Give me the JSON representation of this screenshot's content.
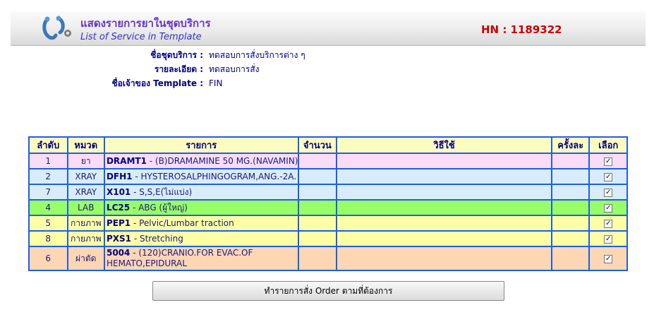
{
  "header": {
    "title_th": "แสดงรายการยาในชุดบริการ",
    "title_en": "List of Service in Template",
    "hn_label": "HN : 1189322",
    "logo_icon": "stethoscope-logo-icon"
  },
  "info": {
    "service_set_label": "ชื่อชุดบริการ :",
    "service_set_value": "ทดสอบการสั่งบริการต่าง ๆ",
    "detail_label": "รายละเอียด :",
    "detail_value": "ทดสอบการสั่ง",
    "owner_label": "ชื่อเจ้าของ Template :",
    "owner_value": "FIN"
  },
  "table": {
    "headers": {
      "seq": "ลำดับ",
      "category": "หมวด",
      "item": "รายการ",
      "quantity": "จำนวน",
      "usage": "วิธีใช้",
      "times": "ครั้งละ",
      "select": "เลือก"
    },
    "rows": [
      {
        "seq": "1",
        "category": "ยา",
        "code": "DRAMT1",
        "desc": " - (B)DRAMAMINE 50 MG.(NAVAMIN)",
        "checked": "✓",
        "color": "#fbdcf5"
      },
      {
        "seq": "2",
        "category": "XRAY",
        "code": "DFH1",
        "desc": " - HYSTEROSALPHINGOGRAM,ANG.-2A.",
        "checked": "✓",
        "color": "#d8ecfb"
      },
      {
        "seq": "7",
        "category": "XRAY",
        "code": "X101",
        "desc": " - S,S,E(ไม่แบ่ง)",
        "checked": "✓",
        "color": "#d8ecfb"
      },
      {
        "seq": "4",
        "category": "LAB",
        "code": "LC25",
        "desc": " - ABG (ผู้ใหญ่)",
        "checked": "✓",
        "color": "#99ff66"
      },
      {
        "seq": "5",
        "category": "กายภาพ",
        "code": "PEP1",
        "desc": " - Pelvic/Lumbar traction",
        "checked": "✓",
        "color": "#fefea6"
      },
      {
        "seq": "8",
        "category": "กายภาพ",
        "code": "PXS1",
        "desc": " - Stretching",
        "checked": "✓",
        "color": "#fefea6"
      },
      {
        "seq": "6",
        "category": "ผ่าตัด",
        "code": "5004",
        "desc": " - (120)CRANIO.FOR EVAC.OF HEMATO,EPIDURAL",
        "checked": "✓",
        "color": "#fdd6b3"
      }
    ]
  },
  "order_button_label": "ทำรายการสั่ง Order ตามที่ต้องการ"
}
